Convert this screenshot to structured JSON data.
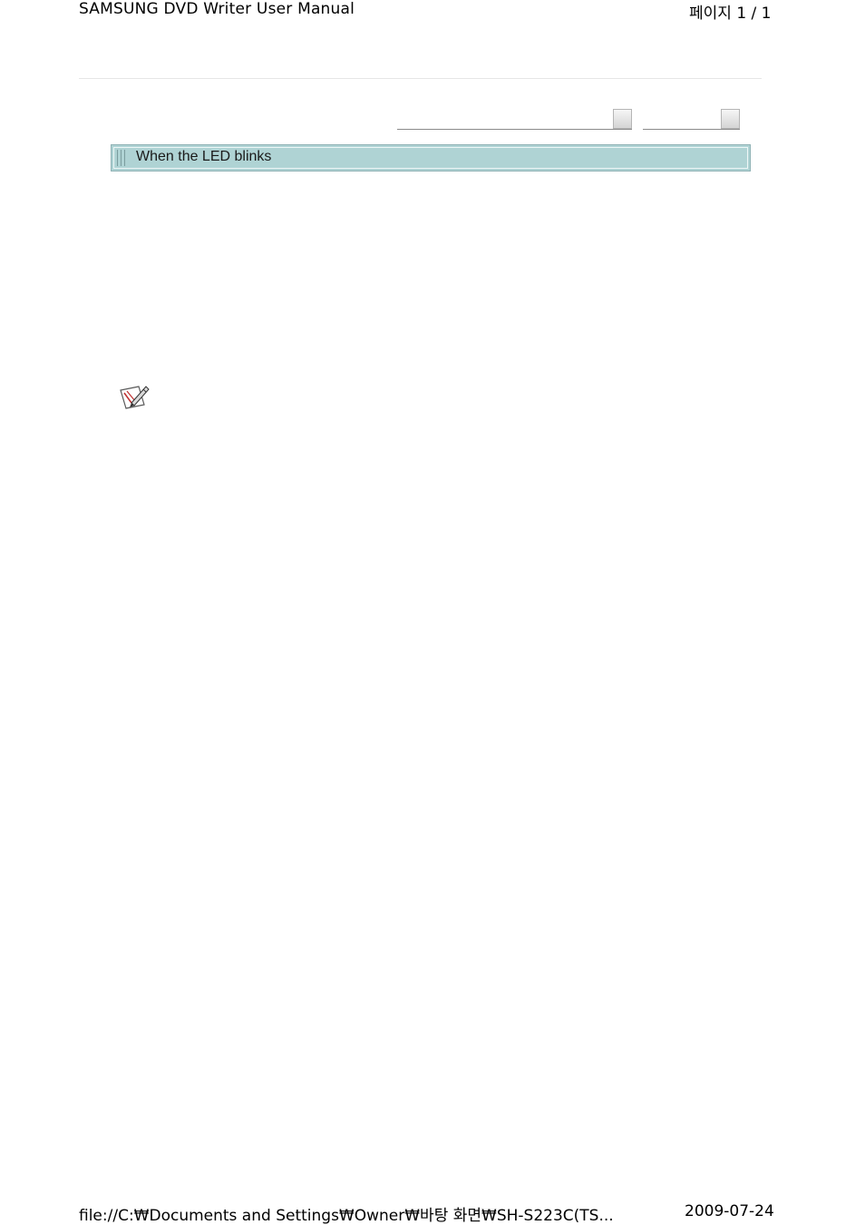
{
  "header": {
    "title": "SAMSUNG DVD Writer User Manual",
    "page_indicator": "페이지 1 / 1"
  },
  "section": {
    "title": "When the LED blinks"
  },
  "icons": {
    "note": "note-pencil-icon"
  },
  "footer": {
    "path": "file://C:₩Documents and Settings₩Owner₩바탕 화면₩SH-S223C(TS...",
    "date": "2009-07-24"
  }
}
